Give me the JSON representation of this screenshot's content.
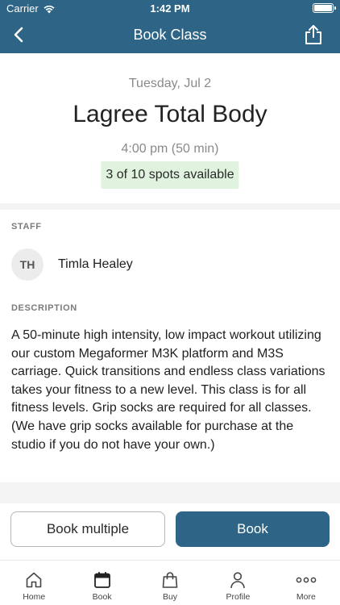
{
  "status_bar": {
    "carrier": "Carrier",
    "time": "1:42 PM"
  },
  "nav": {
    "title": "Book Class"
  },
  "class": {
    "date": "Tuesday, Jul 2",
    "name": "Lagree Total Body",
    "time": "4:00 pm (50 min)",
    "spots": "3 of 10 spots available"
  },
  "staff": {
    "label": "STAFF",
    "initials": "TH",
    "name": "Timla Healey"
  },
  "description": {
    "label": "DESCRIPTION",
    "text": "A 50-minute high intensity, low impact workout utilizing our custom Megaformer M3K platform and M3S carriage. Quick transitions and endless class variations takes your fitness to a new level. This class is for all fitness levels. Grip socks are required for all classes. (We have grip socks available for purchase at the studio if you do not have your own.)"
  },
  "actions": {
    "book_multiple": "Book multiple",
    "book": "Book"
  },
  "tabs": [
    {
      "label": "Home",
      "icon": "home-icon"
    },
    {
      "label": "Book",
      "icon": "calendar-icon"
    },
    {
      "label": "Buy",
      "icon": "shopping-bag-icon"
    },
    {
      "label": "Profile",
      "icon": "person-icon"
    },
    {
      "label": "More",
      "icon": "more-icon"
    }
  ],
  "colors": {
    "brand": "#2e6485",
    "spots_bg": "#dff3df"
  }
}
